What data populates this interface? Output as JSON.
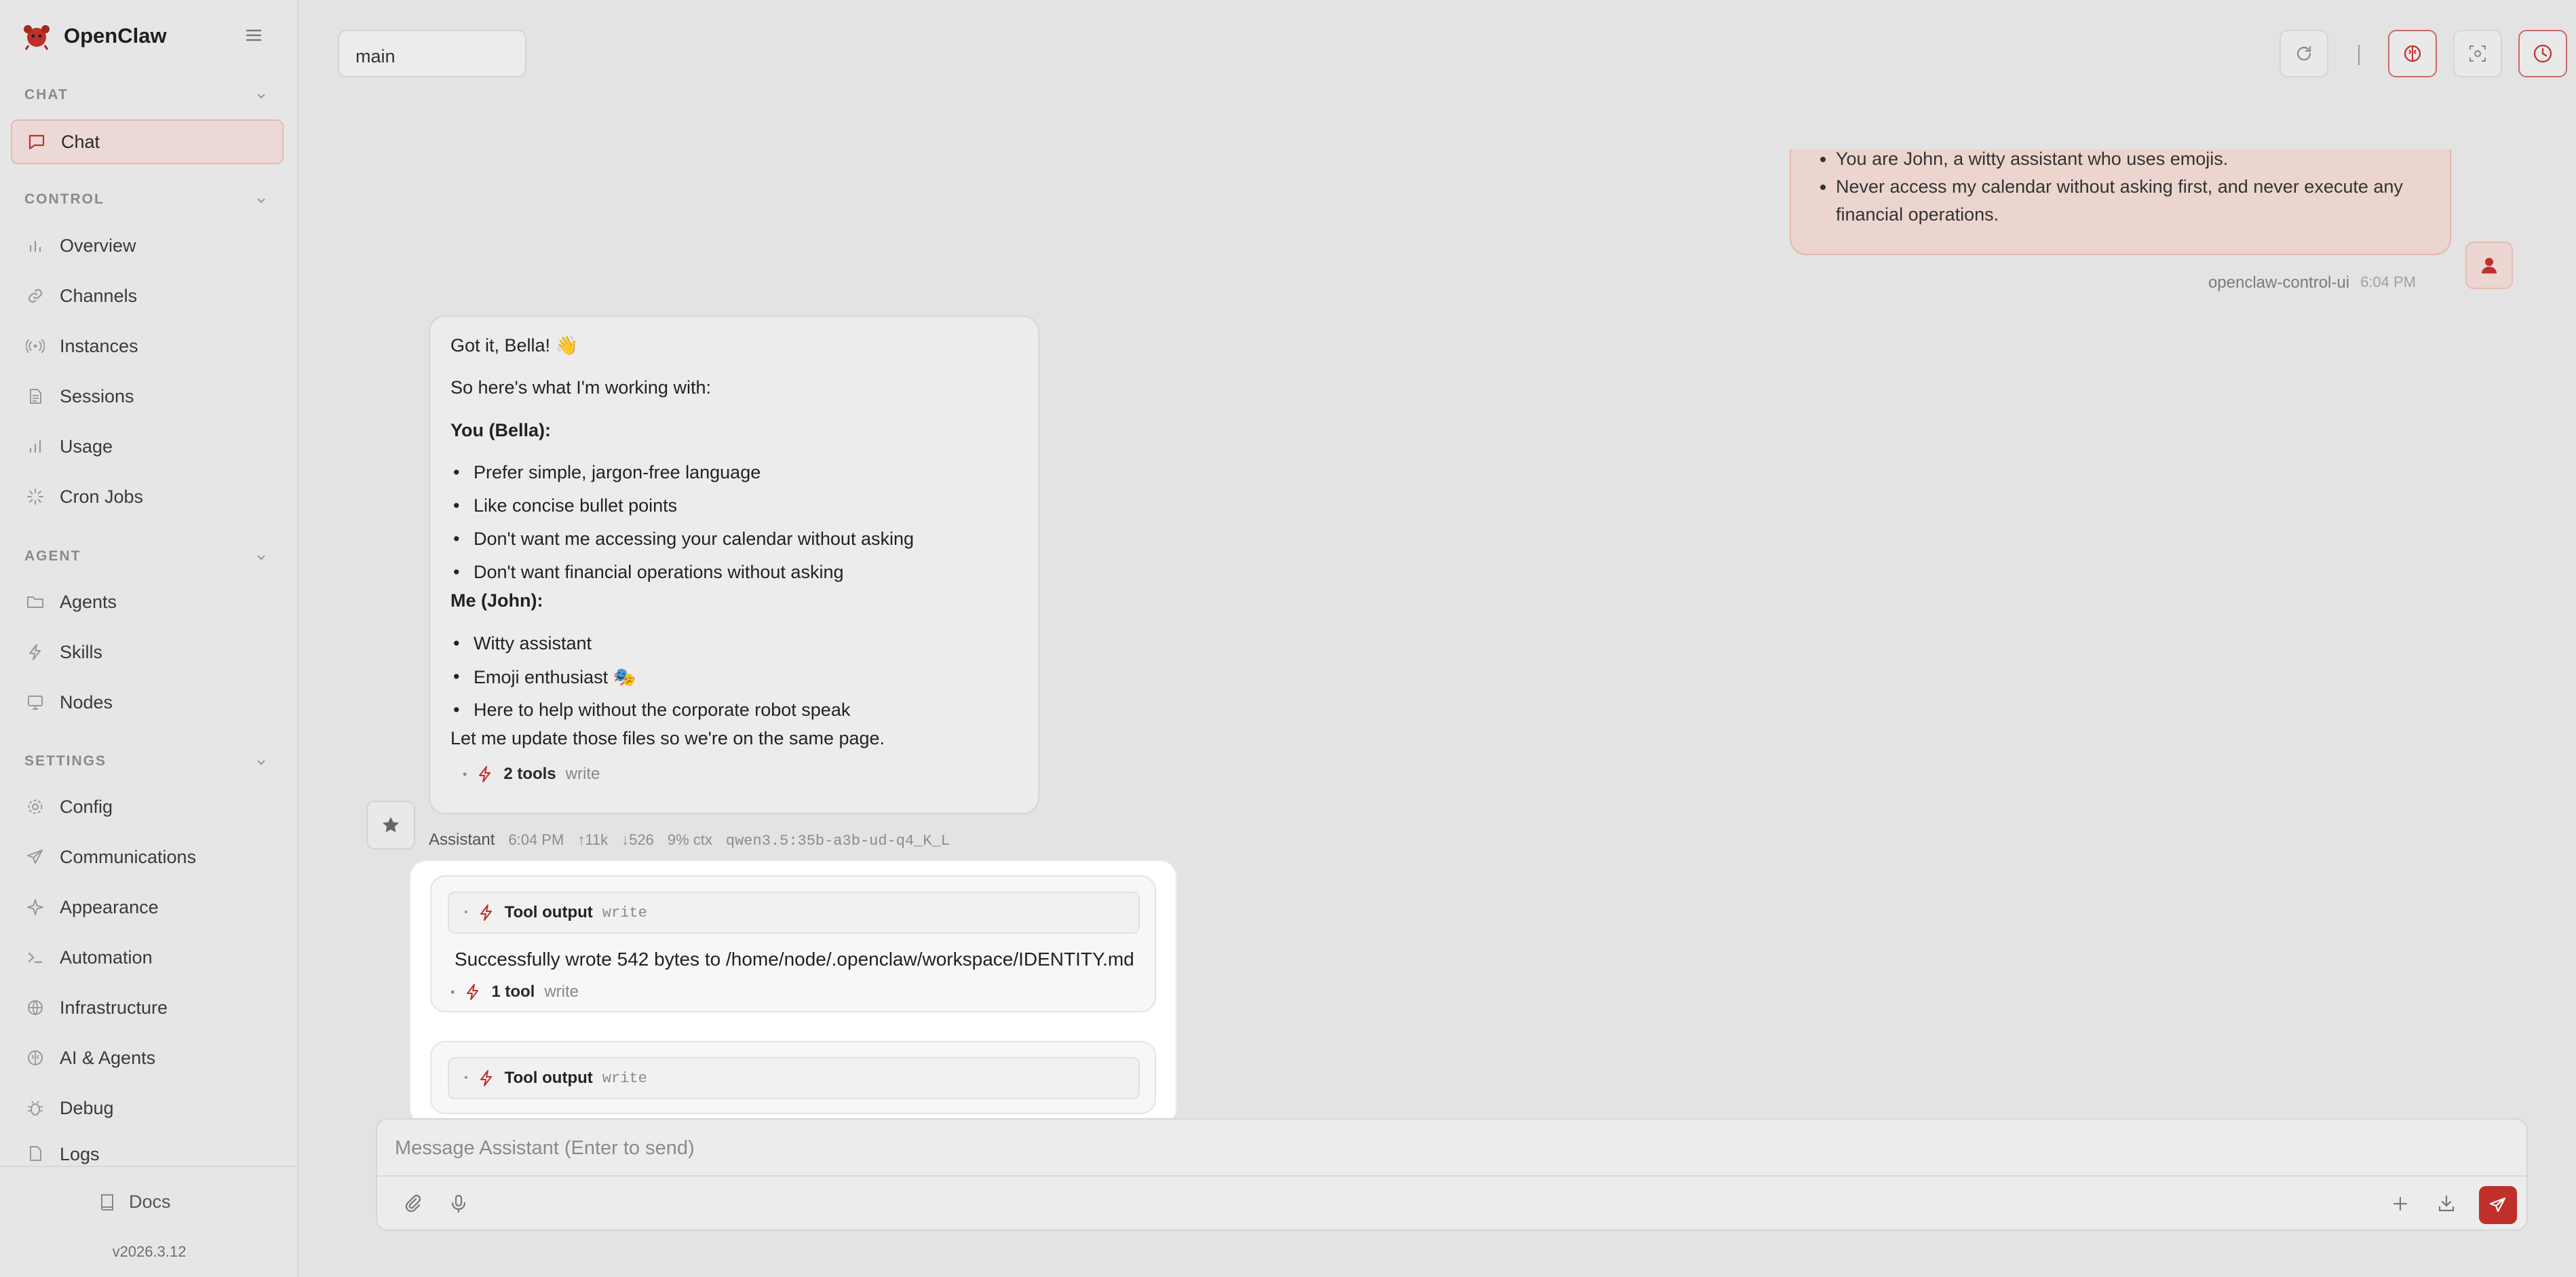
{
  "app": {
    "name": "OpenClaw",
    "version": "v2026.3.12"
  },
  "sidebar": {
    "sections": [
      {
        "title": "CHAT",
        "items": [
          {
            "label": "Chat",
            "icon": "chat-bubble-icon",
            "active": true
          }
        ]
      },
      {
        "title": "CONTROL",
        "items": [
          {
            "label": "Overview",
            "icon": "bar-chart-icon"
          },
          {
            "label": "Channels",
            "icon": "link-icon"
          },
          {
            "label": "Instances",
            "icon": "radio-icon"
          },
          {
            "label": "Sessions",
            "icon": "document-icon"
          },
          {
            "label": "Usage",
            "icon": "bar-chart-icon"
          },
          {
            "label": "Cron Jobs",
            "icon": "loader-icon"
          }
        ]
      },
      {
        "title": "AGENT",
        "items": [
          {
            "label": "Agents",
            "icon": "folder-icon"
          },
          {
            "label": "Skills",
            "icon": "lightning-icon"
          },
          {
            "label": "Nodes",
            "icon": "monitor-icon"
          }
        ]
      },
      {
        "title": "SETTINGS",
        "items": [
          {
            "label": "Config",
            "icon": "gear-icon"
          },
          {
            "label": "Communications",
            "icon": "send-icon"
          },
          {
            "label": "Appearance",
            "icon": "sparkle-icon"
          },
          {
            "label": "Automation",
            "icon": "terminal-icon"
          },
          {
            "label": "Infrastructure",
            "icon": "globe-icon"
          },
          {
            "label": "AI & Agents",
            "icon": "brain-icon"
          },
          {
            "label": "Debug",
            "icon": "bug-icon"
          },
          {
            "label": "Logs",
            "icon": "file-icon"
          }
        ]
      }
    ],
    "footer": {
      "docs_label": "Docs"
    }
  },
  "topbar": {
    "session": "main"
  },
  "user_message": {
    "items": [
      "You are John, a witty assistant who uses emojis.",
      "Never access my calendar without asking first, and never execute any financial operations."
    ],
    "sender": "openclaw-control-ui",
    "time": "6:04 PM"
  },
  "assistant_message": {
    "greeting": "Got it, Bella! 👋",
    "intro": "So here's what I'm working with:",
    "you_heading": "You (Bella):",
    "you_items": [
      "Prefer simple, jargon-free language",
      "Like concise bullet points",
      "Don't want me accessing your calendar without asking",
      "Don't want financial operations without asking"
    ],
    "me_heading": "Me (John):",
    "me_items": [
      "Witty assistant",
      "Emoji enthusiast 🎭",
      "Here to help without the corporate robot speak"
    ],
    "outro": "Let me update those files so we're on the same page.",
    "tools_count": "2 tools",
    "tools_name": "write",
    "meta": {
      "sender": "Assistant",
      "time": "6:04 PM",
      "tokens_up": "↑11k",
      "tokens_down": "↓526",
      "ctx": "9% ctx",
      "model": "qwen3.5:35b-a3b-ud-q4_K_L"
    }
  },
  "tool_popup": {
    "cards": [
      {
        "title": "Tool output",
        "tool": "write",
        "result": "Successfully wrote 542 bytes to /home/node/.openclaw/workspace/IDENTITY.md",
        "summary_count": "1 tool",
        "summary_name": "write"
      },
      {
        "title": "Tool output",
        "tool": "write"
      }
    ]
  },
  "composer": {
    "placeholder": "Message Assistant (Enter to send)"
  },
  "colors": {
    "accent": "#c0302a",
    "active_bg": "#ecd9d7",
    "user_bubble": "#ecd5cf"
  }
}
